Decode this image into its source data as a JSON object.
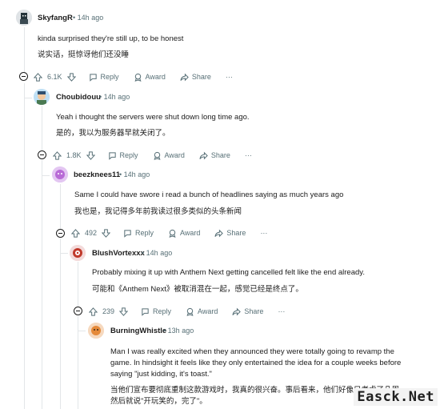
{
  "comments": [
    {
      "username": "SkyfangR",
      "time": "14h ago",
      "text_lines": [
        "kinda surprised they're still up, to be honest"
      ],
      "zh_lines": [
        "说实话，挺惊讶他们还没睡"
      ],
      "votes": "6.1K"
    },
    {
      "username": "Choubidouu",
      "time": "14h ago",
      "text_lines": [
        "Yeah i thought the servers were shut down long time ago."
      ],
      "zh_lines": [
        "是的，我以为服务器早就关闭了。"
      ],
      "votes": "1.8K"
    },
    {
      "username": "beezknees11",
      "time": "14h ago",
      "text_lines": [
        "Same I could have swore i read a bunch of headlines saying as much years ago"
      ],
      "zh_lines": [
        "我也是，我记得多年前我读过很多类似的头条新闻"
      ],
      "votes": "492"
    },
    {
      "username": "BlushVortexxx",
      "time": "14h ago",
      "text_lines": [
        "Probably mixing it up with Anthem Next getting cancelled felt like the end already."
      ],
      "zh_lines": [
        "可能和《Anthem Next》被取消混在一起，感觉已经是终点了。"
      ],
      "votes": "239"
    },
    {
      "username": "BurningWhistle",
      "time": "13h ago",
      "text_lines": [
        "Man I was really excited when they announced they were totally going to revamp the",
        "game. In hindsight it feels like they only entertained the idea for a couple weeks before",
        "saying \"just kidding, it's toast.\""
      ],
      "zh_lines": [
        "当他们宣布要彻底重制这款游戏时，我真的很兴奋。事后看来，他们好像只考虑了几周，",
        "然后就说\"开玩笑的，完了\"。"
      ]
    }
  ],
  "labels": {
    "reply": "Reply",
    "award": "Award",
    "share": "Share",
    "more": "···",
    "dot": "•"
  },
  "watermark": "Easck.Net",
  "colors": {
    "text": "#1c1c1c",
    "meta": "#576f76",
    "thread_line": "#e3e6e8"
  },
  "icons": [
    "upvote-icon",
    "downvote-icon",
    "reply-icon",
    "award-icon",
    "share-icon",
    "collapse-icon"
  ]
}
